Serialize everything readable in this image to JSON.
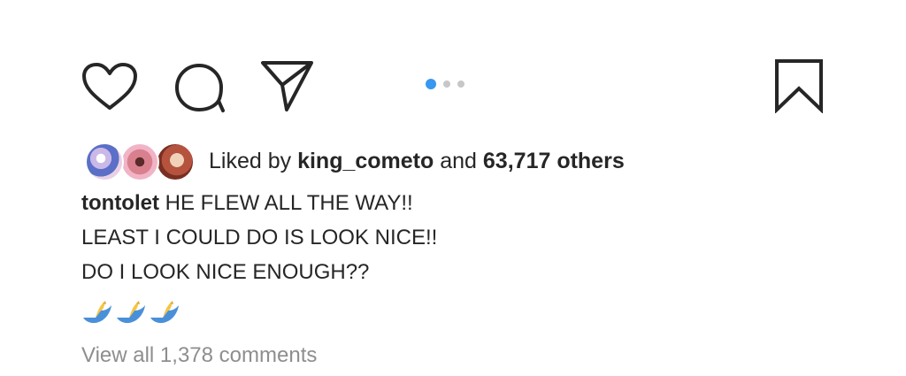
{
  "actions": {
    "icons": [
      "heart-icon",
      "comment-icon",
      "share-icon",
      "bookmark-icon"
    ]
  },
  "carousel": {
    "total": 3,
    "active_index": 0,
    "active_color": "#3897f0",
    "inactive_color": "#c7c7c7"
  },
  "likes": {
    "prefix": "Liked by",
    "user": "king_cometo",
    "joiner": "and",
    "count_text": "63,717 others"
  },
  "caption": {
    "username": "tontolet",
    "line1": "HE FLEW ALL THE WAY!!",
    "line2": "LEAST I COULD DO IS LOOK NICE!!",
    "line3": "DO I LOOK NICE ENOUGH??",
    "emoji": [
      "praying-hands-emoji",
      "praying-hands-emoji",
      "praying-hands-emoji"
    ]
  },
  "comments": {
    "view_all": "View all 1,378 comments"
  },
  "colors": {
    "text": "#262626",
    "muted": "#8e8e8e"
  }
}
